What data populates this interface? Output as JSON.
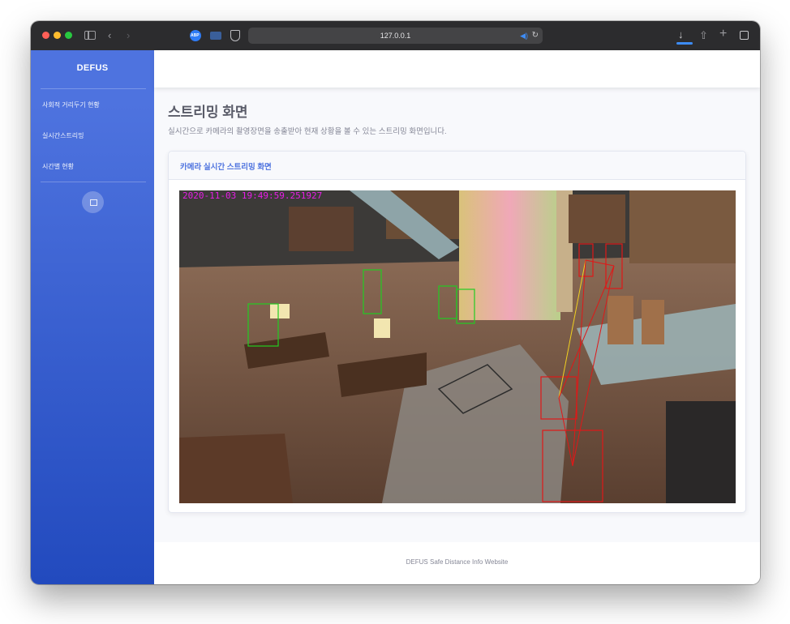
{
  "browser": {
    "url": "127.0.0.1"
  },
  "sidebar": {
    "brand": "DEFUS",
    "items": [
      {
        "label": "사회적 거리두기 현황"
      },
      {
        "label": "실시간스트리밍"
      },
      {
        "label": "시간별 현황"
      }
    ]
  },
  "main": {
    "title": "스트리밍 화면",
    "subtitle": "실시간으로 카메라의 촬영장면을 송출받아 현재 상황을 볼 수 있는 스트리밍 화면입니다.",
    "card": {
      "title": "카메라 실시간 스트리밍 화면",
      "timestamp": "2020-11-03 19:49:59.251927"
    }
  },
  "footer": {
    "text": "DEFUS Safe Distance Info Website"
  },
  "colors": {
    "primary": "#4e73df",
    "sidebar_gradient_end": "#224abe",
    "box_safe": "#22cc22",
    "box_violation": "#e01818",
    "timestamp": "#e61ee6"
  }
}
